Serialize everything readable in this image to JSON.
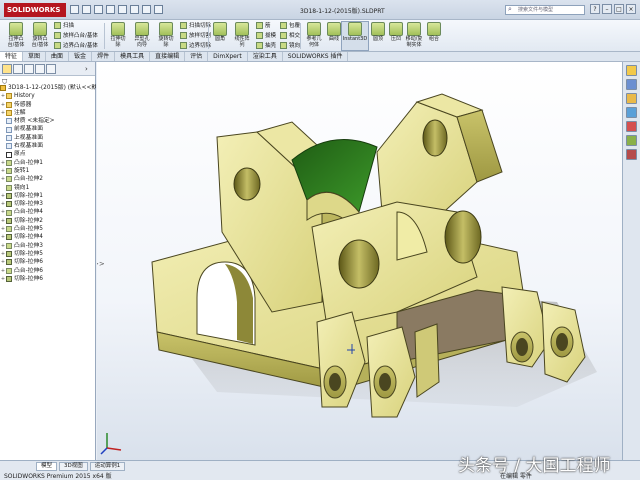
{
  "app": {
    "logo_text": "SOLIDWORKS",
    "document_title": "3D18-1-12-(2015版).SLDPRT",
    "search_placeholder": "搜索文件与模型"
  },
  "ribbon": {
    "large_buttons": [
      {
        "id": "extrude-boss",
        "label": "拉伸凸\n台/基体"
      },
      {
        "id": "revolve-boss",
        "label": "旋转凸\n台/基体"
      },
      {
        "id": "extrude-cut",
        "label": "拉伸切\n除"
      },
      {
        "id": "hole-wizard",
        "label": "异型孔\n向导"
      },
      {
        "id": "revolve-cut",
        "label": "旋转切\n除"
      },
      {
        "id": "fillet",
        "label": "圆角"
      },
      {
        "id": "linear-pattern",
        "label": "线性阵\n列"
      },
      {
        "id": "reference-geometry",
        "label": "参考几\n何体"
      },
      {
        "id": "curves",
        "label": "曲线"
      },
      {
        "id": "instant3d",
        "label": "Instant3D"
      },
      {
        "id": "dome",
        "label": "圆顶"
      },
      {
        "id": "flex",
        "label": "压凹"
      },
      {
        "id": "move-copy-body",
        "label": "移动/复\n制实体"
      },
      {
        "id": "combine",
        "label": "组合"
      }
    ],
    "small_buttons": [
      {
        "id": "sweep",
        "label": "扫描"
      },
      {
        "id": "loft-boss",
        "label": "放样凸台/基体"
      },
      {
        "id": "boundary-boss",
        "label": "边界凸台/基体"
      },
      {
        "id": "swept-cut",
        "label": "扫描切除"
      },
      {
        "id": "lofted-cut",
        "label": "放样切割"
      },
      {
        "id": "boundary-cut",
        "label": "边界切除"
      },
      {
        "id": "rib",
        "label": "筋"
      },
      {
        "id": "draft",
        "label": "拔模"
      },
      {
        "id": "shell",
        "label": "抽壳"
      },
      {
        "id": "wrap",
        "label": "包覆"
      },
      {
        "id": "intersect",
        "label": "相交"
      },
      {
        "id": "mirror",
        "label": "镜向"
      }
    ]
  },
  "command_tabs": [
    "特征",
    "草图",
    "曲面",
    "钣金",
    "焊件",
    "模具工具",
    "直接编辑",
    "评估",
    "DimXpert",
    "渲染工具",
    "SOLIDWORKS 插件"
  ],
  "feature_tree": {
    "filter_icon": "filter-icon",
    "collapse_label": ">>",
    "items": [
      {
        "label": "3D18-1-12-(2015版)  (默认<<默认>",
        "kind": "root",
        "expander": ""
      },
      {
        "label": "History",
        "kind": "folder",
        "expander": "+"
      },
      {
        "label": "传感器",
        "kind": "folder",
        "expander": "+"
      },
      {
        "label": "注解",
        "kind": "folder",
        "expander": "+"
      },
      {
        "label": "材质 <未指定>",
        "kind": "plane",
        "expander": ""
      },
      {
        "label": "前视基准面",
        "kind": "plane",
        "expander": ""
      },
      {
        "label": "上视基准面",
        "kind": "plane",
        "expander": ""
      },
      {
        "label": "右视基准面",
        "kind": "plane",
        "expander": ""
      },
      {
        "label": "原点",
        "kind": "origin",
        "expander": ""
      },
      {
        "label": "凸台-拉伸1",
        "kind": "feature",
        "expander": "+"
      },
      {
        "label": "旋转1",
        "kind": "feature",
        "expander": "+"
      },
      {
        "label": "凸台-拉伸2",
        "kind": "feature",
        "expander": "+"
      },
      {
        "label": "镜向1",
        "kind": "feature",
        "expander": ""
      },
      {
        "label": "切除-拉伸1",
        "kind": "cut",
        "expander": "+"
      },
      {
        "label": "切除-拉伸3",
        "kind": "cut",
        "expander": "+"
      },
      {
        "label": "凸台-拉伸4",
        "kind": "feature",
        "expander": "+"
      },
      {
        "label": "切除-拉伸2",
        "kind": "cut",
        "expander": "+"
      },
      {
        "label": "凸台-拉伸5",
        "kind": "feature",
        "expander": "+"
      },
      {
        "label": "切除-拉伸4",
        "kind": "cut",
        "expander": "+"
      },
      {
        "label": "凸台-拉伸3",
        "kind": "feature",
        "expander": "+"
      },
      {
        "label": "切除-拉伸5",
        "kind": "cut",
        "expander": "+"
      },
      {
        "label": "切除-拉伸6",
        "kind": "cut",
        "expander": "+"
      },
      {
        "label": "凸台-拉伸6",
        "kind": "feature",
        "expander": "+"
      },
      {
        "label": "切除-拉伸6",
        "kind": "cut",
        "expander": "+"
      }
    ]
  },
  "status_bar": {
    "bottom_tabs": [
      "模型",
      "3D视图",
      "运动算例1"
    ],
    "text": "SOLIDWORKS Premium 2015 x64 版",
    "right_text": "在编辑 零件"
  },
  "watermark": "头条号 / 大国工程师",
  "colors": {
    "part_face": "#e8e39a",
    "part_dark": "#a8a24a",
    "part_hole": "#6b6620",
    "green_inner": "#2d7a1e",
    "titlebar": "#c9d4e3",
    "logo_red": "#b5161f"
  }
}
